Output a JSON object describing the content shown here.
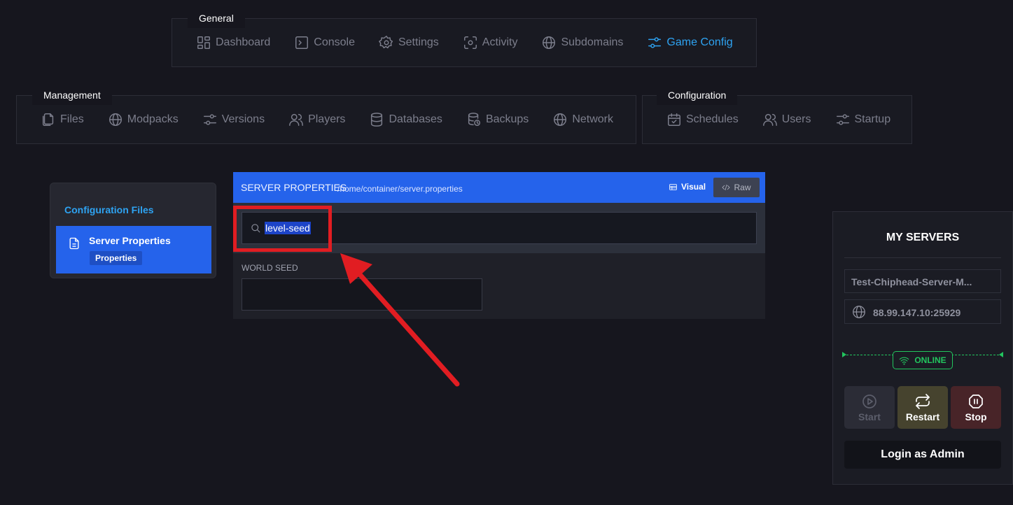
{
  "nav": {
    "general": {
      "legend": "General",
      "items": [
        {
          "label": "Dashboard",
          "icon": "dashboard-icon"
        },
        {
          "label": "Console",
          "icon": "console-icon"
        },
        {
          "label": "Settings",
          "icon": "gear-icon"
        },
        {
          "label": "Activity",
          "icon": "activity-icon"
        },
        {
          "label": "Subdomains",
          "icon": "globe-icon"
        },
        {
          "label": "Game Config",
          "icon": "sliders-icon",
          "active": true
        }
      ]
    },
    "management": {
      "legend": "Management",
      "items": [
        {
          "label": "Files",
          "icon": "files-icon"
        },
        {
          "label": "Modpacks",
          "icon": "globe-icon"
        },
        {
          "label": "Versions",
          "icon": "sliders-icon"
        },
        {
          "label": "Players",
          "icon": "users-icon"
        },
        {
          "label": "Databases",
          "icon": "database-icon"
        },
        {
          "label": "Backups",
          "icon": "backup-icon"
        },
        {
          "label": "Network",
          "icon": "globe-icon"
        }
      ]
    },
    "configuration": {
      "legend": "Configuration",
      "items": [
        {
          "label": "Schedules",
          "icon": "calendar-icon"
        },
        {
          "label": "Users",
          "icon": "users-icon"
        },
        {
          "label": "Startup",
          "icon": "sliders-icon"
        }
      ]
    }
  },
  "config_files": {
    "title": "Configuration Files",
    "items": [
      {
        "name": "Server Properties",
        "tag": "Properties",
        "icon": "file-icon"
      }
    ]
  },
  "properties": {
    "title": "SERVER PROPERTIES",
    "path": "/home/container/server.properties",
    "visual_label": "Visual",
    "raw_label": "Raw",
    "search_value": "level-seed",
    "field_label": "WORLD SEED",
    "field_value": ""
  },
  "servers": {
    "title": "MY SERVERS",
    "server_name": "Test-Chiphead-Server-M...",
    "server_address": "88.99.147.10:25929",
    "status": "ONLINE",
    "start_label": "Start",
    "restart_label": "Restart",
    "stop_label": "Stop",
    "login_label": "Login as Admin"
  },
  "colors": {
    "accent": "#2563eb",
    "active_nav": "#2ea3f2",
    "online": "#22c55e",
    "annotation": "#e11d22"
  }
}
